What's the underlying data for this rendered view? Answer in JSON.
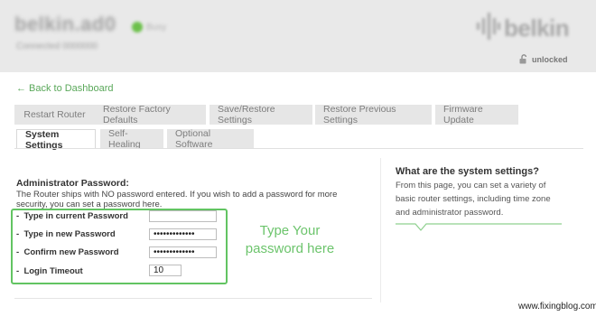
{
  "header": {
    "title": "belkin.ad0",
    "status": "Busy",
    "subtitle": "Connected 0000000",
    "logo_text": "belkin",
    "lock_label": "unlocked"
  },
  "nav": {
    "back_link": "Back to Dashboard",
    "tabs_row1": [
      "Restart Router",
      "Restore Factory Defaults",
      "Save/Restore Settings",
      "Restore Previous Settings",
      "Firmware Update"
    ],
    "tabs_row2": [
      "System Settings",
      "Self-Healing",
      "Optional Software"
    ],
    "active_tab": "System Settings"
  },
  "admin": {
    "title": "Administrator Password:",
    "description": "The Router ships with NO password entered. If you wish to add a password for more security, you can set a password here.",
    "fields": [
      {
        "label": "Type in current Password",
        "value": ""
      },
      {
        "label": "Type in new Password",
        "value": "•••••••••••••"
      },
      {
        "label": "Confirm new Password",
        "value": "•••••••••••••"
      },
      {
        "label": "Login Timeout",
        "value": "10"
      }
    ],
    "annotation": "Type Your password here",
    "highlight_color": "#62c462"
  },
  "help": {
    "title": "What are the system settings?",
    "text": "From this page, you can set a variety of basic router settings, including time zone and administrator password."
  },
  "watermark": "www.fixingblog.com",
  "colors": {
    "accent": "#5aa85a",
    "header_bg": "#e9e9e9",
    "tab_bg": "#e6e6e6"
  }
}
